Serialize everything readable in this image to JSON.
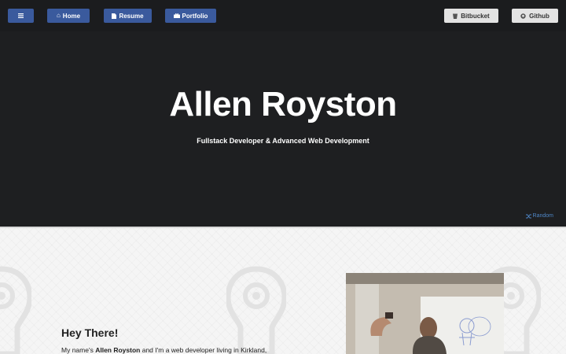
{
  "nav": {
    "menu_icon": "hamburger-icon",
    "home_label": "Home",
    "resume_label": "Resume",
    "portfolio_label": "Portfolio",
    "bitbucket_label": "Bitbucket",
    "github_label": "Github"
  },
  "hero": {
    "name": "Allen Royston",
    "tagline": "Fullstack Developer & Advanced Web Development",
    "random_label": "Random"
  },
  "about": {
    "heading": "Hey There!",
    "intro_prefix": "My name's ",
    "intro_name": "Allen Royston",
    "intro_suffix": " and I'm a web developer living in Kirkland,"
  },
  "colors": {
    "hero_bg": "#1e1f21",
    "nav_blue": "#3a5a9d",
    "link_blue": "#4f86c6"
  }
}
